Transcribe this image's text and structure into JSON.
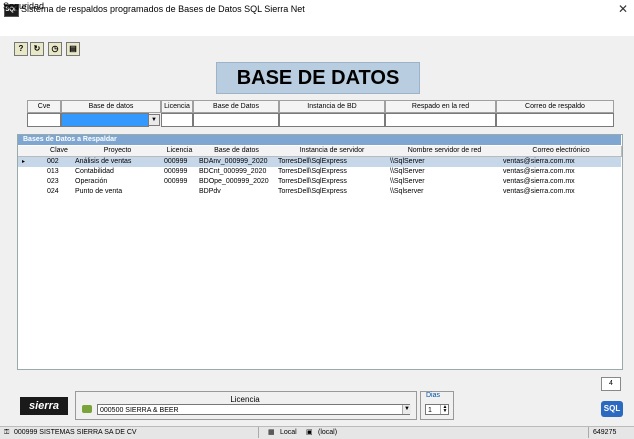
{
  "window": {
    "title": "Sistema de respaldos programados de Bases de Datos SQL Sierra Net",
    "close_glyph": "✕"
  },
  "menu": {
    "items": [
      "Seguridad"
    ]
  },
  "toolbar": {
    "icons": [
      "help-pointer-icon",
      "refresh-icon",
      "timer-icon",
      "card-icon"
    ]
  },
  "header": {
    "title": "BASE DE DATOS"
  },
  "filter": {
    "columns": [
      "Cve",
      "Base de datos",
      "Licencia",
      "Base de Datos",
      "Instancia de BD",
      "Respado en la red",
      "Correo de respaldo"
    ]
  },
  "grid": {
    "caption": "Bases de Datos a Respaldar",
    "columns": [
      "Clave",
      "Proyecto",
      "Licencia",
      "Base de datos",
      "Instancia de servidor",
      "Nombre servidor de red",
      "Correo electrónico"
    ],
    "rows": [
      {
        "clave": "002",
        "proyecto": "Análisis de ventas",
        "licencia": "000999",
        "bd": "BDAnv_000999_2020",
        "instancia": "TorresDell\\SqlExpress",
        "servidor": "\\\\SqlServer",
        "correo": "ventas@sierra.com.mx",
        "selected": true
      },
      {
        "clave": "013",
        "proyecto": "Contabilidad",
        "licencia": "000999",
        "bd": "BDCnt_000999_2020",
        "instancia": "TorresDell\\SqlExpress",
        "servidor": "\\\\SqlServer",
        "correo": "ventas@sierra.com.mx",
        "selected": false
      },
      {
        "clave": "023",
        "proyecto": "Operación",
        "licencia": "000999",
        "bd": "BDOpe_000999_2020",
        "instancia": "TorresDell\\SqlExpress",
        "servidor": "\\\\SqlServer",
        "correo": "ventas@sierra.com.mx",
        "selected": false
      },
      {
        "clave": "024",
        "proyecto": "Punto de venta",
        "licencia": "",
        "bd": "BDPdv",
        "instancia": "TorresDell\\SqlExpress",
        "servidor": "\\\\Sqlserver",
        "correo": "ventas@sierra.com.mx",
        "selected": false
      }
    ],
    "row_indicator": "▸"
  },
  "pager": {
    "value": "4"
  },
  "logo": {
    "text": "sierra"
  },
  "license": {
    "label": "Licencia",
    "value": "000500  SIERRA & BEER"
  },
  "days": {
    "label": "Dias",
    "value": "1"
  },
  "sql_logo": {
    "text": "SQL"
  },
  "status": {
    "company": "000999  SISTEMAS SIERRA SA DE CV",
    "mode": "Local",
    "server": "(local)",
    "code": "649275"
  },
  "colors": {
    "header_bg": "#b8cde0",
    "caption_bg": "#7ea6d0",
    "selected_row": "#c6d7ea"
  }
}
